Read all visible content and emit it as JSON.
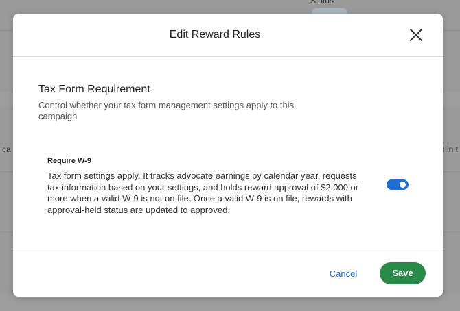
{
  "background": {
    "header_partial_text": "Status",
    "left_partial_text": "ca",
    "right_partial_text": "d in t"
  },
  "modal": {
    "title": "Edit Reward Rules",
    "close_icon": "close-icon",
    "section": {
      "title": "Tax Form Requirement",
      "description": "Control whether your tax form management settings apply to this campaign"
    },
    "option": {
      "label": "Require W-9",
      "description": "Tax form settings apply. It tracks advocate earnings by calendar year, requests tax information based on your settings, and holds reward approval of $2,000 or more when a valid W-9 is not on file. Once a valid W-9 is on file, rewards with approval-held status are updated to approved.",
      "toggle_on": true
    },
    "footer": {
      "cancel_label": "Cancel",
      "save_label": "Save"
    }
  },
  "colors": {
    "accent_blue": "#1f6fd1",
    "save_green": "#2a8a4a",
    "backdrop": "#9a9a9a"
  }
}
